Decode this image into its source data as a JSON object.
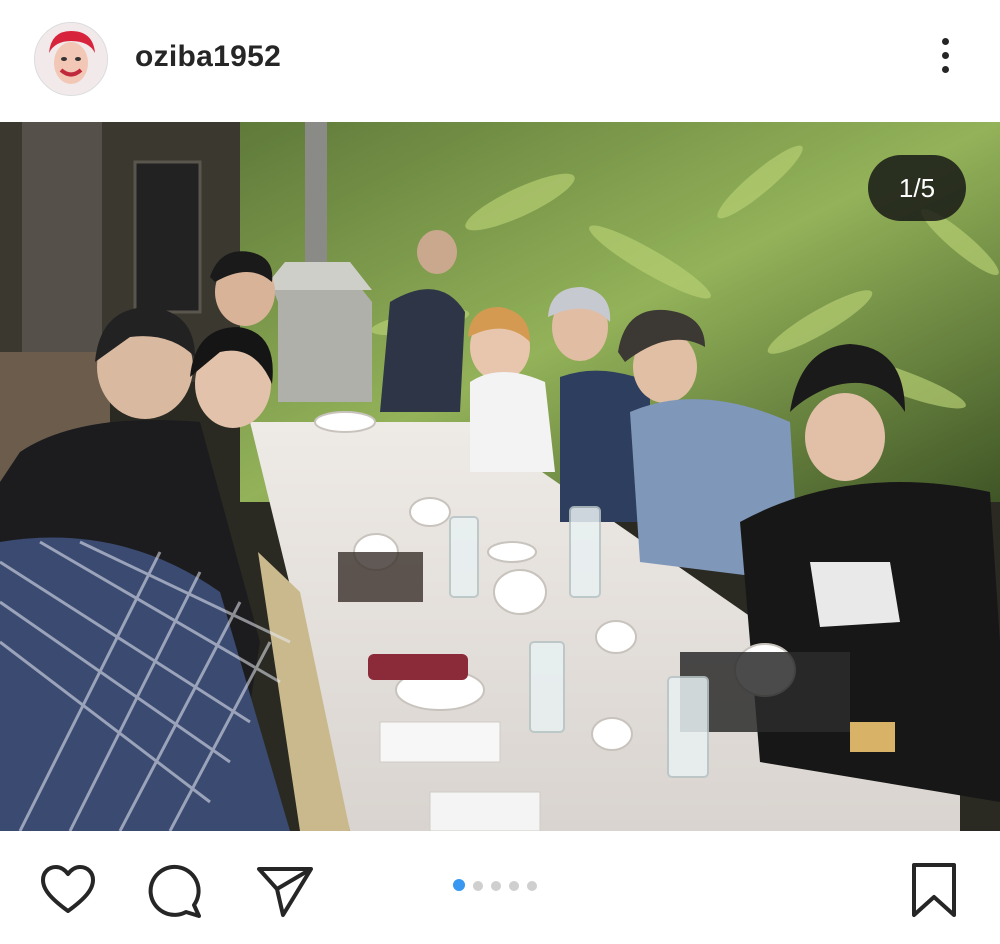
{
  "post": {
    "username": "oziba1952",
    "counter": "1/5",
    "total_slides": 5,
    "current_slide": 1
  },
  "icons": {
    "more": "more-vertical-icon",
    "like": "heart-icon",
    "comment": "comment-icon",
    "share": "send-icon",
    "save": "bookmark-icon"
  },
  "colors": {
    "active_dot": "#3897f0",
    "inactive_dot": "#cfcfcf",
    "icon": "#262626"
  }
}
